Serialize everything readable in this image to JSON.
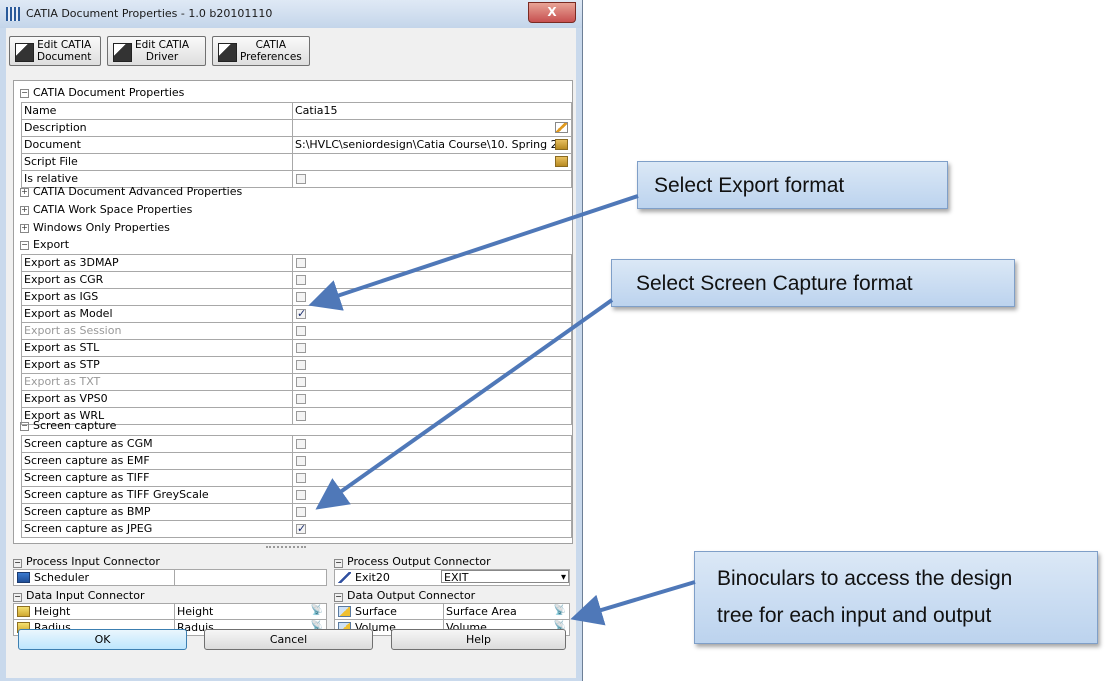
{
  "window": {
    "title": "CATIA Document Properties - 1.0 b20101110",
    "close": "X"
  },
  "toolbar": {
    "edit_document": [
      "Edit CATIA",
      "Document"
    ],
    "edit_driver": [
      "Edit CATIA",
      "Driver"
    ],
    "preferences": [
      "CATIA",
      "Preferences"
    ]
  },
  "sections": {
    "doc_props": "CATIA Document Properties",
    "adv_props": "CATIA Document Advanced Properties",
    "workspace": "CATIA Work Space Properties",
    "windows_only": "Windows Only Properties",
    "export": "Export",
    "screen_capture": "Screen capture"
  },
  "doc_props": [
    {
      "key": "Name",
      "value": "Catia15"
    },
    {
      "key": "Description",
      "value": ""
    },
    {
      "key": "Document",
      "value": "S:\\HVLC\\seniordesign\\Catia Course\\10. Spring 2..."
    },
    {
      "key": "Script File",
      "value": ""
    },
    {
      "key": "Is relative",
      "checked": false
    }
  ],
  "export": [
    {
      "key": "Export as 3DMAP",
      "checked": false,
      "disabled": false
    },
    {
      "key": "Export as CGR",
      "checked": false,
      "disabled": false
    },
    {
      "key": "Export as IGS",
      "checked": false,
      "disabled": false
    },
    {
      "key": "Export as Model",
      "checked": true,
      "disabled": false
    },
    {
      "key": "Export as Session",
      "checked": false,
      "disabled": true
    },
    {
      "key": "Export as STL",
      "checked": false,
      "disabled": false
    },
    {
      "key": "Export as STP",
      "checked": false,
      "disabled": false
    },
    {
      "key": "Export as TXT",
      "checked": false,
      "disabled": true
    },
    {
      "key": "Export as VPS0",
      "checked": false,
      "disabled": false
    },
    {
      "key": "Export as WRL",
      "checked": false,
      "disabled": false
    }
  ],
  "screen_capture": [
    {
      "key": "Screen capture as CGM",
      "checked": false
    },
    {
      "key": "Screen capture as EMF",
      "checked": false
    },
    {
      "key": "Screen capture as TIFF",
      "checked": false
    },
    {
      "key": "Screen capture as TIFF GreyScale",
      "checked": false
    },
    {
      "key": "Screen capture as BMP",
      "checked": false
    },
    {
      "key": "Screen capture as JPEG",
      "checked": true
    }
  ],
  "connectors": {
    "process_input": {
      "title": "Process Input Connector",
      "rows": [
        {
          "name": "Scheduler",
          "value": ""
        }
      ]
    },
    "process_output": {
      "title": "Process Output Connector",
      "rows": [
        {
          "name": "Exit20",
          "value": "EXIT"
        }
      ]
    },
    "data_input": {
      "title": "Data Input Connector",
      "rows": [
        {
          "name": "Height",
          "value": "Height"
        },
        {
          "name": "Radius",
          "value": "Raduis"
        }
      ]
    },
    "data_output": {
      "title": "Data Output Connector",
      "rows": [
        {
          "name": "Surface",
          "value": "Surface Area"
        },
        {
          "name": "Volume",
          "value": "Volume"
        }
      ]
    }
  },
  "buttons": {
    "ok": "OK",
    "cancel": "Cancel",
    "help": "Help"
  },
  "callouts": {
    "export": "Select Export format",
    "screen": "Select Screen Capture format",
    "binoculars": [
      "Binoculars to access the design",
      "tree for each input and output"
    ]
  },
  "colors": {
    "arrow": "#4f78b8",
    "checkmark": "#1c2e6e"
  },
  "icons": {
    "binoculars": "binoculars-icon",
    "folder": "folder-icon",
    "edit": "edit-icon"
  }
}
